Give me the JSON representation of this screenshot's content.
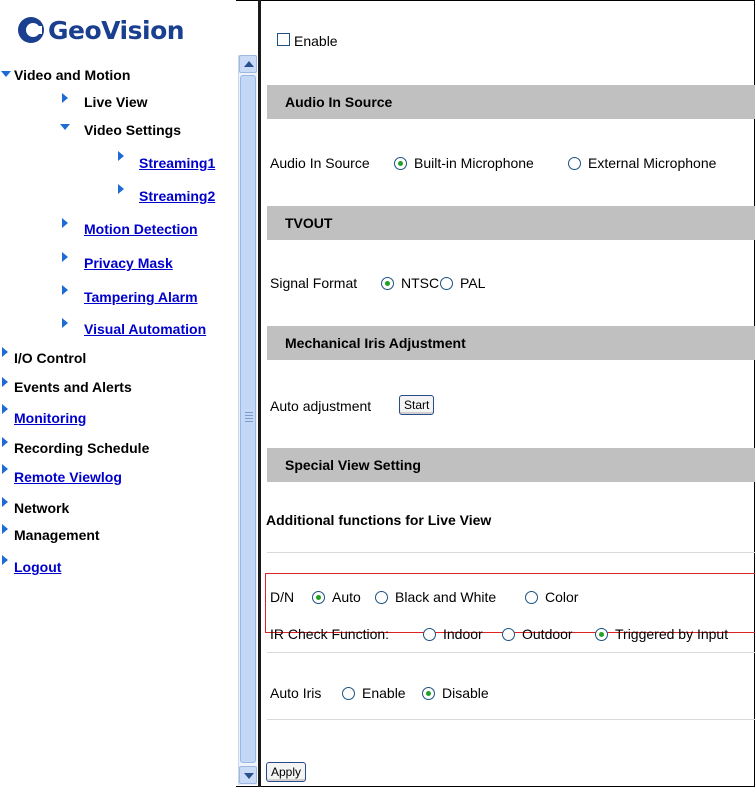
{
  "brand": {
    "name": "GeoVision"
  },
  "nav": {
    "video_motion": "Video and Motion",
    "live_view": "Live View",
    "video_settings": "Video Settings",
    "streaming1": "Streaming1",
    "streaming2": "Streaming2",
    "motion_detection": "Motion Detection",
    "privacy_mask": "Privacy Mask",
    "tampering_alarm": "Tampering Alarm",
    "visual_automation": "Visual Automation",
    "io_control": "I/O Control",
    "events_alerts": "Events and Alerts",
    "monitoring": "Monitoring",
    "recording_schedule": "Recording Schedule",
    "remote_viewlog": "Remote Viewlog",
    "network": "Network",
    "management": "Management",
    "logout": "Logout"
  },
  "main": {
    "enable_label": "Enable",
    "enable_checked": false,
    "audio_header": "Audio In Source",
    "audio_label": "Audio In Source",
    "audio_opt1": "Built-in Microphone",
    "audio_opt2": "External Microphone",
    "audio_selected": "Built-in Microphone",
    "tvout_header": "TVOUT",
    "signal_label": "Signal Format",
    "signal_opt1": "NTSC",
    "signal_opt2": "PAL",
    "signal_selected": "NTSC",
    "iris_header": "Mechanical Iris Adjustment",
    "auto_adj_label": "Auto adjustment",
    "start_button": "Start",
    "special_header": "Special View Setting",
    "additional_label": "Additional functions for Live View",
    "dn_label": "D/N",
    "dn_opt1": "Auto",
    "dn_opt2": "Black and White",
    "dn_opt3": "Color",
    "dn_selected": "Auto",
    "ir_label": "IR Check Function:",
    "ir_opt1": "Indoor",
    "ir_opt2": "Outdoor",
    "ir_opt3": "Triggered by Input",
    "ir_selected": "Triggered by Input",
    "autoiris_label": "Auto Iris",
    "autoiris_opt1": "Enable",
    "autoiris_opt2": "Disable",
    "autoiris_selected": "Disable",
    "apply_button": "Apply"
  },
  "colors": {
    "nav_link": "#0000cc",
    "arrow": "#1e6bd6",
    "section_header": "#c0c0c0",
    "highlight_border": "#dd2222",
    "radio_dot": "#21a121"
  }
}
